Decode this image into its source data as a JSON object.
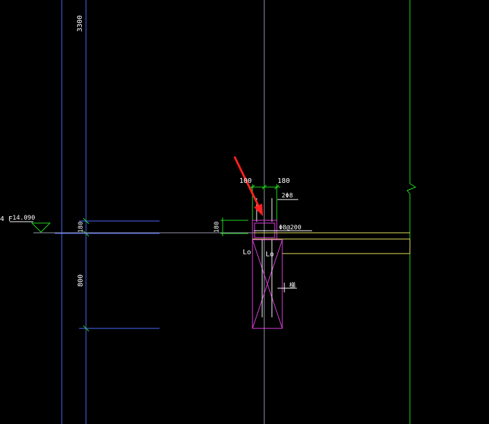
{
  "colors": {
    "background": "#000000",
    "grid_blue": "#4a6cff",
    "axis_gray": "#9a9ab0",
    "green": "#22dd22",
    "magenta": "#e040e0",
    "yellow": "#e8e860",
    "white": "#ffffff",
    "red_arrow": "#ff2020"
  },
  "labels": {
    "height_3300": "3300",
    "height_180_left": "180",
    "height_800": "800",
    "height_180_mid": "180",
    "dim_100": "100",
    "dim_180": "180",
    "floor_tag": "4 F",
    "elevation": "14.090",
    "rebar_top": "2Φ8",
    "stirrup": "Φ8@200",
    "lo_left": "Lo",
    "lo_right": "Lo",
    "beam_tag": "梯"
  }
}
